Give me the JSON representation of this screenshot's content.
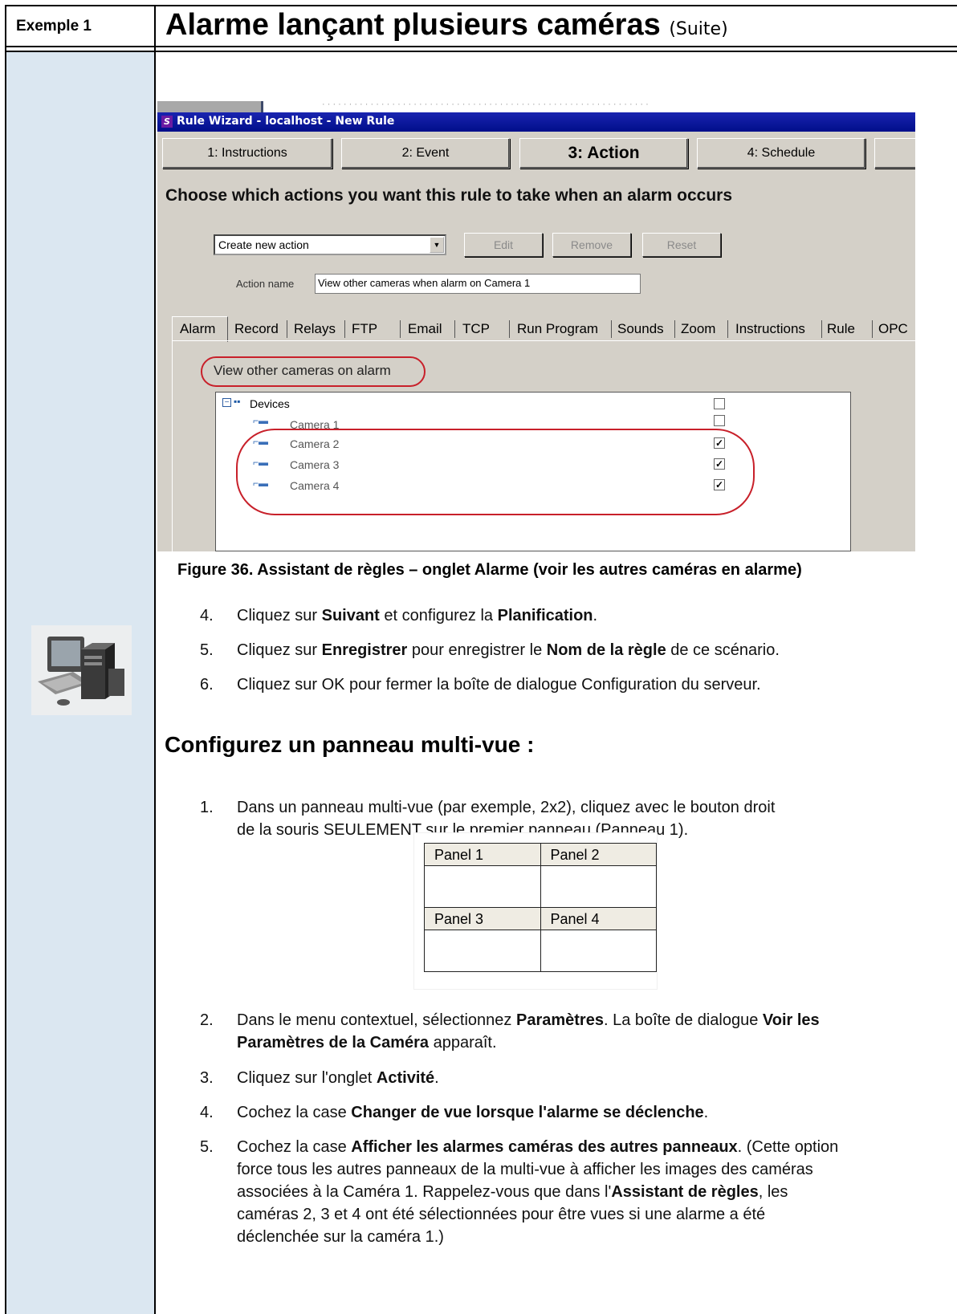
{
  "header": {
    "example_label": "Exemple 1",
    "title_main": "Alarme lançant plusieurs caméras",
    "title_suffix": "(Suite)"
  },
  "wizard": {
    "window_title": "Rule Wizard - localhost - New Rule",
    "steps": [
      "1: Instructions",
      "2: Event",
      "3: Action",
      "4: Schedule"
    ],
    "active_step": "3: Action",
    "question": "Choose which actions you want this rule to take when an alarm occurs",
    "action_select": "Create new action",
    "buttons": {
      "edit": "Edit",
      "remove": "Remove",
      "reset": "Reset"
    },
    "action_name_label": "Action name",
    "action_name_value": "View other cameras when alarm on Camera 1",
    "tabs": [
      "Alarm",
      "Record",
      "Relays",
      "FTP",
      "Email",
      "TCP",
      "Run Program",
      "Sounds",
      "Zoom",
      "Instructions",
      "Rule",
      "OPC"
    ],
    "active_tab": "Alarm",
    "view_other_label": "View other cameras on alarm",
    "tree": {
      "root": "Devices",
      "root_checked": false,
      "cameras": [
        {
          "name": "Camera 1",
          "checked": false
        },
        {
          "name": "Camera 2",
          "checked": true
        },
        {
          "name": "Camera 3",
          "checked": true
        },
        {
          "name": "Camera 4",
          "checked": true
        }
      ]
    }
  },
  "caption": "Figure 36. Assistant de règles – onglet Alarme (voir les autres caméras en alarme)",
  "steps_a": [
    {
      "num": "4.",
      "parts": [
        [
          "Cliquez sur ",
          false
        ],
        [
          "Suivant",
          true
        ],
        [
          " et configurez la ",
          false
        ],
        [
          "Planification",
          true
        ],
        [
          ".",
          false
        ]
      ]
    },
    {
      "num": "5.",
      "parts": [
        [
          "Cliquez sur ",
          false
        ],
        [
          "Enregistrer",
          true
        ],
        [
          " pour enregistrer le ",
          false
        ],
        [
          "Nom de la règle",
          true
        ],
        [
          " de ce scénario.",
          false
        ]
      ]
    },
    {
      "num": "6.",
      "parts": [
        [
          "Cliquez sur OK pour fermer la boîte de dialogue Configuration du serveur.",
          false
        ]
      ]
    }
  ],
  "sub_heading": "Configurez un panneau multi-vue :",
  "step_b1": {
    "num": "1.",
    "line1": "Dans un panneau multi-vue (par exemple, 2x2), cliquez avec le bouton droit",
    "line2": "de la souris SEULEMENT sur le premier panneau (Panneau 1)."
  },
  "panels": [
    "Panel 1",
    "Panel 2",
    "Panel 3",
    "Panel 4"
  ],
  "steps_c": [
    {
      "num": "2.",
      "lines": [
        [
          [
            "Dans le menu contextuel, sélectionnez ",
            false
          ],
          [
            "Paramètres",
            true
          ],
          [
            ". La boîte de dialogue ",
            false
          ],
          [
            "Voir les",
            true
          ]
        ],
        [
          [
            "Paramètres de la Caméra",
            true
          ],
          [
            " apparaît.",
            false
          ]
        ]
      ]
    },
    {
      "num": "3.",
      "lines": [
        [
          [
            "Cliquez sur l'onglet ",
            false
          ],
          [
            "Activité",
            true
          ],
          [
            ".",
            false
          ]
        ]
      ]
    },
    {
      "num": "4.",
      "lines": [
        [
          [
            "Cochez la case ",
            false
          ],
          [
            "Changer de vue lorsque l'alarme se déclenche",
            true
          ],
          [
            ".",
            false
          ]
        ]
      ]
    },
    {
      "num": "5.",
      "lines": [
        [
          [
            "Cochez la case ",
            false
          ],
          [
            "Afficher les alarmes caméras des autres panneaux",
            true
          ],
          [
            ". (Cette option",
            false
          ]
        ],
        [
          [
            "force tous les autres panneaux de la multi-vue à afficher les images des caméras",
            false
          ]
        ],
        [
          [
            "associées à la Caméra 1. Rappelez-vous que dans l'",
            false
          ],
          [
            "Assistant de règles",
            true
          ],
          [
            ", les",
            false
          ]
        ],
        [
          [
            "caméras 2, 3 et 4 ont été sélectionnées pour être vues si une alarme a été",
            false
          ]
        ],
        [
          [
            "déclenchée sur la caméra 1.)",
            false
          ]
        ]
      ]
    }
  ],
  "colors": {
    "accent_panel": "#dbe7f1",
    "highlight_red": "#c8202a",
    "titlebar": "#000e8a"
  }
}
